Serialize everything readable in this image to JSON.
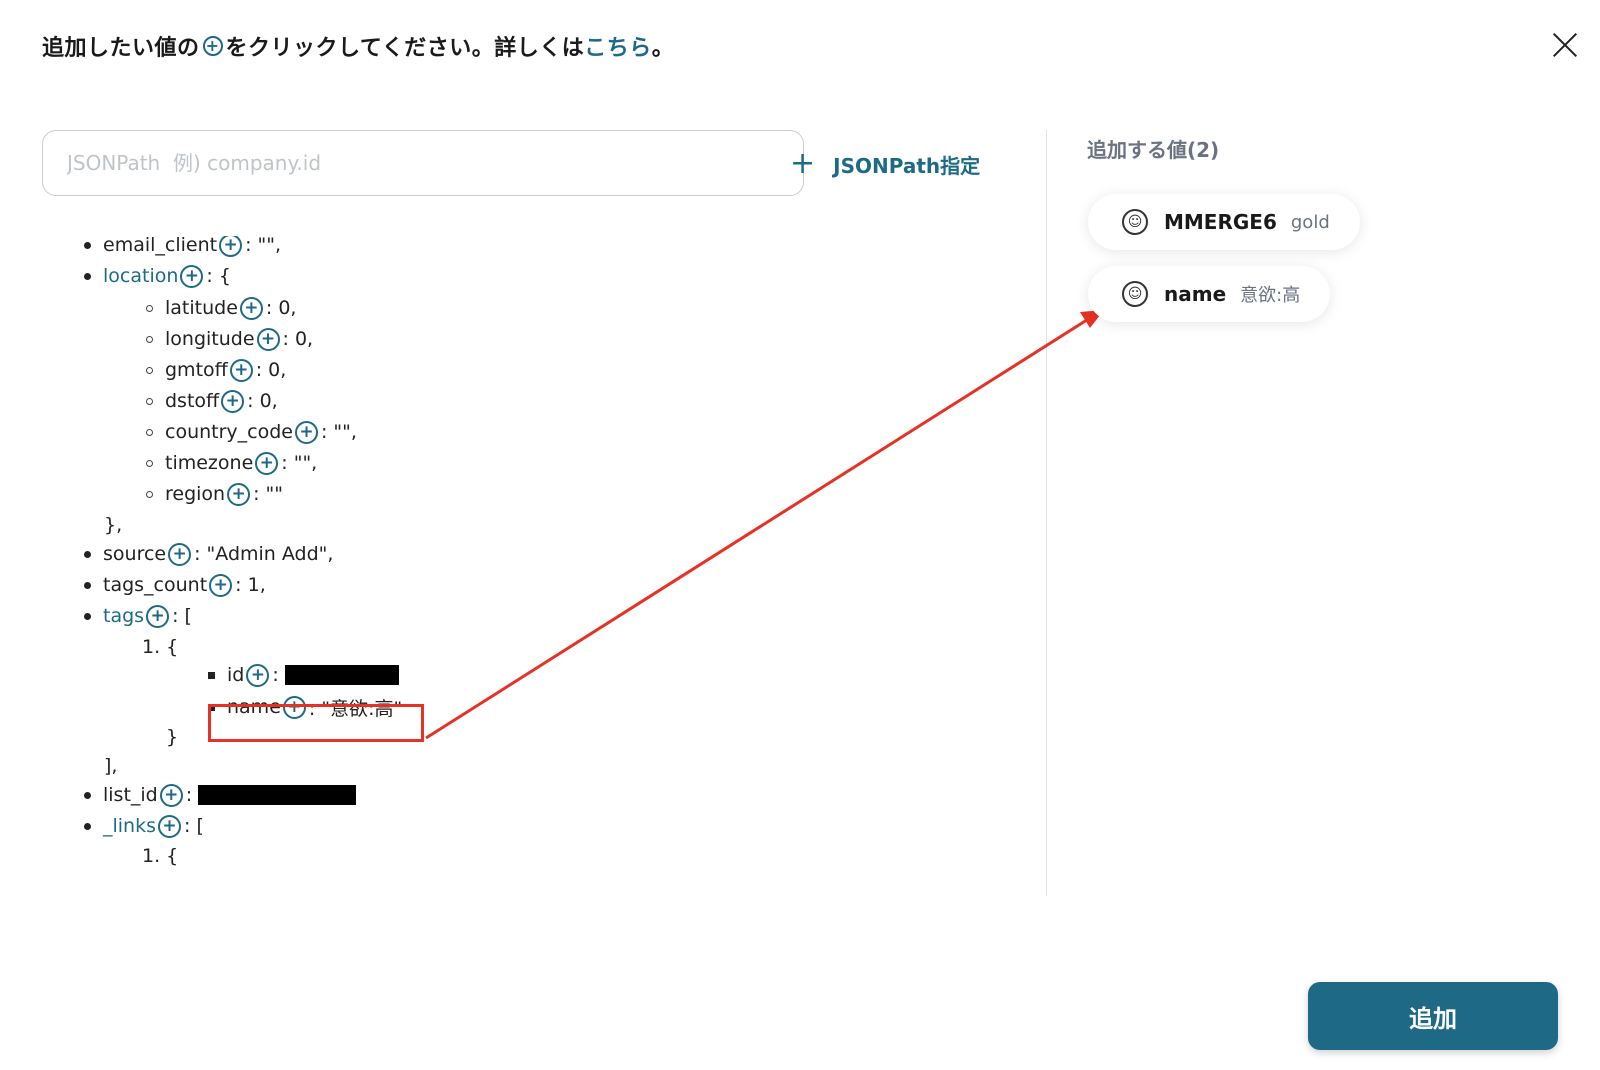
{
  "header": {
    "instruction_prefix": "追加したい値の",
    "instruction_middle": "をクリックしてください。詳しくは",
    "instruction_link": "こちら",
    "instruction_suffix": "。"
  },
  "search": {
    "placeholder": "JSONPath  例) company.id",
    "value": ""
  },
  "jsonpath_button": {
    "icon": "plus-icon",
    "label": "JSONPath指定"
  },
  "tree": {
    "email_client": {
      "key": "email_client",
      "value": ": \"\","
    },
    "location": {
      "key": "location",
      "value": ": {"
    },
    "latitude": {
      "key": "latitude",
      "value": ": 0,"
    },
    "longitude": {
      "key": "longitude",
      "value": ": 0,"
    },
    "gmtoff": {
      "key": "gmtoff",
      "value": ": 0,"
    },
    "dstoff": {
      "key": "dstoff",
      "value": ": 0,"
    },
    "country_code": {
      "key": "country_code",
      "value": ": \"\","
    },
    "timezone": {
      "key": "timezone",
      "value": ": \"\","
    },
    "region": {
      "key": "region",
      "value": ": \"\""
    },
    "location_close": "},",
    "source": {
      "key": "source",
      "value": ": \"Admin Add\","
    },
    "tags_count": {
      "key": "tags_count",
      "value": ": 1,"
    },
    "tags": {
      "key": "tags",
      "value": ": ["
    },
    "tags_item_open": "1. {",
    "tag_id": {
      "key": "id",
      "value": ":"
    },
    "tag_name": {
      "key": "name",
      "value": ": \"意欲:高\""
    },
    "tags_item_close": "}",
    "tags_close": "],",
    "list_id": {
      "key": "list_id",
      "value": ":"
    },
    "links": {
      "key": "_links",
      "value": ": ["
    },
    "links_item_open": "1. {"
  },
  "added_values": {
    "label": "追加する値(2)",
    "items": [
      {
        "key": "MMERGE6",
        "value": "gold",
        "icon": "mailchimp-icon"
      },
      {
        "key": "name",
        "value": "意欲:高",
        "icon": "mailchimp-icon"
      }
    ]
  },
  "add_button": {
    "label": "追加"
  },
  "colors": {
    "accent": "#1e6a86",
    "highlight": "#e53224"
  }
}
